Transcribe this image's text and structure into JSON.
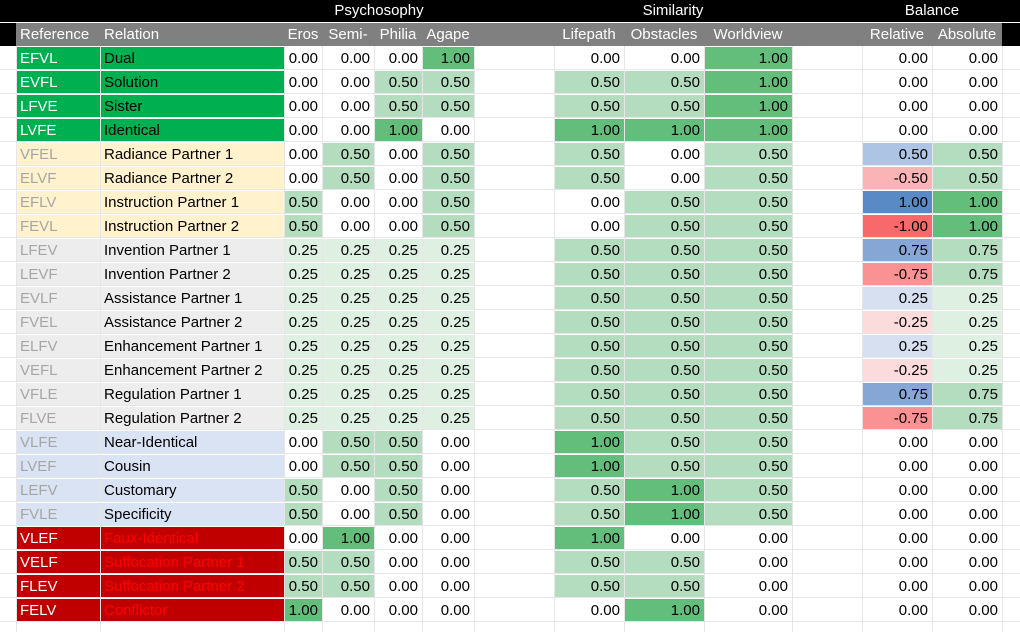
{
  "group_headers": [
    {
      "label": "Psychosophy",
      "key": "psy"
    },
    {
      "label": "Similarity",
      "key": "sim"
    },
    {
      "label": "Balance",
      "key": "bal"
    }
  ],
  "headers": {
    "reference": "Reference",
    "relation": "Relation",
    "eros": "Eros",
    "semi": "Semi-",
    "philia": "Philia",
    "agape": "Agape",
    "lifepath": "Lifepath",
    "obstacles": "Obstacles",
    "worldview": "Worldview",
    "relative": "Relative",
    "absolute": "Absolute"
  },
  "colors": {
    "group_green": "#00b050",
    "group_cream": "#fff2cc",
    "group_gray": "#ededed",
    "group_blue": "#dae3f3",
    "group_red": "#c00000",
    "ref_text_light": "#ffffff",
    "ref_text_gray": "#a6a6a6",
    "ref_text_blue": "#a6a6a6",
    "ref_text_red": "#ffffff",
    "red_relation_text": "#ff0000"
  },
  "rows": [
    {
      "ref": "EFVL",
      "relation": "Dual",
      "group": "green",
      "eros": "0.00",
      "semi": "0.00",
      "philia": "0.00",
      "agape": "1.00",
      "lifepath": "0.00",
      "obstacles": "0.00",
      "worldview": "1.00",
      "relative": "0.00",
      "absolute": "0.00"
    },
    {
      "ref": "EVFL",
      "relation": "Solution",
      "group": "green",
      "eros": "0.00",
      "semi": "0.00",
      "philia": "0.50",
      "agape": "0.50",
      "lifepath": "0.50",
      "obstacles": "0.50",
      "worldview": "1.00",
      "relative": "0.00",
      "absolute": "0.00"
    },
    {
      "ref": "LFVE",
      "relation": "Sister",
      "group": "green",
      "eros": "0.00",
      "semi": "0.00",
      "philia": "0.50",
      "agape": "0.50",
      "lifepath": "0.50",
      "obstacles": "0.50",
      "worldview": "1.00",
      "relative": "0.00",
      "absolute": "0.00"
    },
    {
      "ref": "LVFE",
      "relation": "Identical",
      "group": "green",
      "eros": "0.00",
      "semi": "0.00",
      "philia": "1.00",
      "agape": "0.00",
      "lifepath": "1.00",
      "obstacles": "1.00",
      "worldview": "1.00",
      "relative": "0.00",
      "absolute": "0.00"
    },
    {
      "ref": "VFEL",
      "relation": "Radiance Partner 1",
      "group": "cream",
      "eros": "0.00",
      "semi": "0.50",
      "philia": "0.00",
      "agape": "0.50",
      "lifepath": "0.50",
      "obstacles": "0.00",
      "worldview": "0.50",
      "relative": "0.50",
      "absolute": "0.50"
    },
    {
      "ref": "ELVF",
      "relation": "Radiance Partner 2",
      "group": "cream",
      "eros": "0.00",
      "semi": "0.50",
      "philia": "0.00",
      "agape": "0.50",
      "lifepath": "0.50",
      "obstacles": "0.00",
      "worldview": "0.50",
      "relative": "-0.50",
      "absolute": "0.50"
    },
    {
      "ref": "EFLV",
      "relation": "Instruction Partner 1",
      "group": "cream",
      "eros": "0.50",
      "semi": "0.00",
      "philia": "0.00",
      "agape": "0.50",
      "lifepath": "0.00",
      "obstacles": "0.50",
      "worldview": "0.50",
      "relative": "1.00",
      "absolute": "1.00"
    },
    {
      "ref": "FEVL",
      "relation": "Instruction Partner 2",
      "group": "cream",
      "eros": "0.50",
      "semi": "0.00",
      "philia": "0.00",
      "agape": "0.50",
      "lifepath": "0.00",
      "obstacles": "0.50",
      "worldview": "0.50",
      "relative": "-1.00",
      "absolute": "1.00"
    },
    {
      "ref": "LFEV",
      "relation": "Invention Partner 1",
      "group": "gray",
      "eros": "0.25",
      "semi": "0.25",
      "philia": "0.25",
      "agape": "0.25",
      "lifepath": "0.50",
      "obstacles": "0.50",
      "worldview": "0.50",
      "relative": "0.75",
      "absolute": "0.75"
    },
    {
      "ref": "LEVF",
      "relation": "Invention Partner 2",
      "group": "gray",
      "eros": "0.25",
      "semi": "0.25",
      "philia": "0.25",
      "agape": "0.25",
      "lifepath": "0.50",
      "obstacles": "0.50",
      "worldview": "0.50",
      "relative": "-0.75",
      "absolute": "0.75"
    },
    {
      "ref": "EVLF",
      "relation": "Assistance Partner 1",
      "group": "gray",
      "eros": "0.25",
      "semi": "0.25",
      "philia": "0.25",
      "agape": "0.25",
      "lifepath": "0.50",
      "obstacles": "0.50",
      "worldview": "0.50",
      "relative": "0.25",
      "absolute": "0.25"
    },
    {
      "ref": "FVEL",
      "relation": "Assistance Partner 2",
      "group": "gray",
      "eros": "0.25",
      "semi": "0.25",
      "philia": "0.25",
      "agape": "0.25",
      "lifepath": "0.50",
      "obstacles": "0.50",
      "worldview": "0.50",
      "relative": "-0.25",
      "absolute": "0.25"
    },
    {
      "ref": "ELFV",
      "relation": "Enhancement Partner 1",
      "group": "gray",
      "eros": "0.25",
      "semi": "0.25",
      "philia": "0.25",
      "agape": "0.25",
      "lifepath": "0.50",
      "obstacles": "0.50",
      "worldview": "0.50",
      "relative": "0.25",
      "absolute": "0.25"
    },
    {
      "ref": "VEFL",
      "relation": "Enhancement Partner 2",
      "group": "gray",
      "eros": "0.25",
      "semi": "0.25",
      "philia": "0.25",
      "agape": "0.25",
      "lifepath": "0.50",
      "obstacles": "0.50",
      "worldview": "0.50",
      "relative": "-0.25",
      "absolute": "0.25"
    },
    {
      "ref": "VFLE",
      "relation": "Regulation Partner 1",
      "group": "gray",
      "eros": "0.25",
      "semi": "0.25",
      "philia": "0.25",
      "agape": "0.25",
      "lifepath": "0.50",
      "obstacles": "0.50",
      "worldview": "0.50",
      "relative": "0.75",
      "absolute": "0.75"
    },
    {
      "ref": "FLVE",
      "relation": "Regulation Partner 2",
      "group": "gray",
      "eros": "0.25",
      "semi": "0.25",
      "philia": "0.25",
      "agape": "0.25",
      "lifepath": "0.50",
      "obstacles": "0.50",
      "worldview": "0.50",
      "relative": "-0.75",
      "absolute": "0.75"
    },
    {
      "ref": "VLFE",
      "relation": "Near-Identical",
      "group": "blue",
      "eros": "0.00",
      "semi": "0.50",
      "philia": "0.50",
      "agape": "0.00",
      "lifepath": "1.00",
      "obstacles": "0.50",
      "worldview": "0.50",
      "relative": "0.00",
      "absolute": "0.00"
    },
    {
      "ref": "LVEF",
      "relation": "Cousin",
      "group": "blue",
      "eros": "0.00",
      "semi": "0.50",
      "philia": "0.50",
      "agape": "0.00",
      "lifepath": "1.00",
      "obstacles": "0.50",
      "worldview": "0.50",
      "relative": "0.00",
      "absolute": "0.00"
    },
    {
      "ref": "LEFV",
      "relation": "Customary",
      "group": "blue",
      "eros": "0.50",
      "semi": "0.00",
      "philia": "0.50",
      "agape": "0.00",
      "lifepath": "0.50",
      "obstacles": "1.00",
      "worldview": "0.50",
      "relative": "0.00",
      "absolute": "0.00"
    },
    {
      "ref": "FVLE",
      "relation": "Specificity",
      "group": "blue",
      "eros": "0.50",
      "semi": "0.00",
      "philia": "0.50",
      "agape": "0.00",
      "lifepath": "0.50",
      "obstacles": "1.00",
      "worldview": "0.50",
      "relative": "0.00",
      "absolute": "0.00"
    },
    {
      "ref": "VLEF",
      "relation": "Faux-Identical",
      "group": "red",
      "eros": "0.00",
      "semi": "1.00",
      "philia": "0.00",
      "agape": "0.00",
      "lifepath": "1.00",
      "obstacles": "0.00",
      "worldview": "0.00",
      "relative": "0.00",
      "absolute": "0.00"
    },
    {
      "ref": "VELF",
      "relation": "Suffocation Partner 1",
      "group": "red",
      "eros": "0.50",
      "semi": "0.50",
      "philia": "0.00",
      "agape": "0.00",
      "lifepath": "0.50",
      "obstacles": "0.50",
      "worldview": "0.00",
      "relative": "0.00",
      "absolute": "0.00"
    },
    {
      "ref": "FLEV",
      "relation": "Suffocation Partner 2",
      "group": "red",
      "eros": "0.50",
      "semi": "0.50",
      "philia": "0.00",
      "agape": "0.00",
      "lifepath": "0.50",
      "obstacles": "0.50",
      "worldview": "0.00",
      "relative": "0.00",
      "absolute": "0.00"
    },
    {
      "ref": "FELV",
      "relation": "Conflictor",
      "group": "red",
      "eros": "1.00",
      "semi": "0.00",
      "philia": "0.00",
      "agape": "0.00",
      "lifepath": "0.00",
      "obstacles": "1.00",
      "worldview": "0.00",
      "relative": "0.00",
      "absolute": "0.00"
    }
  ]
}
